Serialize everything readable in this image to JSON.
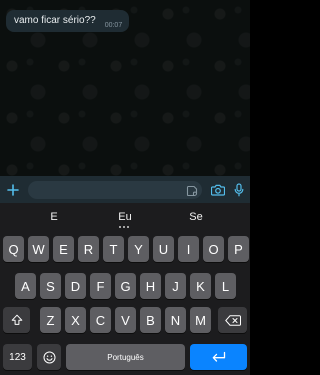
{
  "chat": {
    "message": {
      "text": "vamo ficar sério??",
      "time": "00:07"
    }
  },
  "composer": {
    "plus_icon": "plus-icon",
    "sticker_icon": "sticker-icon",
    "camera_icon": "camera-icon",
    "mic_icon": "microphone-icon",
    "accent_color": "#53bdeb"
  },
  "keyboard": {
    "suggestions": [
      "E",
      "Eu",
      "Se"
    ],
    "row1": [
      "Q",
      "W",
      "E",
      "R",
      "T",
      "Y",
      "U",
      "I",
      "O",
      "P"
    ],
    "row2": [
      "A",
      "S",
      "D",
      "F",
      "G",
      "H",
      "J",
      "K",
      "L"
    ],
    "row3": [
      "Z",
      "X",
      "C",
      "V",
      "B",
      "N",
      "M"
    ],
    "shift_icon": "shift-arrow-icon",
    "backspace_icon": "backspace-icon",
    "numbers_label": "123",
    "emoji_icon": "emoji-icon",
    "space_label": "Português",
    "enter_icon": "return-arrow-icon",
    "enter_color": "#0a84ff"
  }
}
